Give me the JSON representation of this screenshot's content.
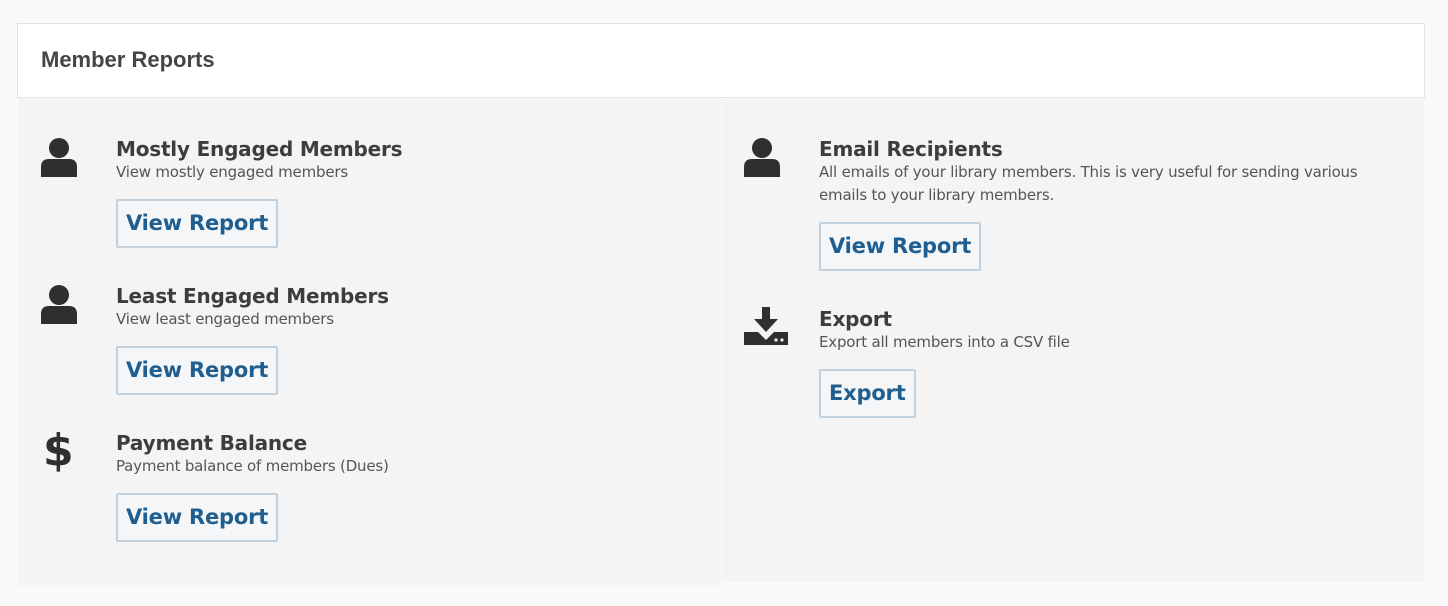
{
  "header": {
    "title": "Member Reports"
  },
  "left_items": [
    {
      "icon": "user-icon",
      "title": "Mostly Engaged Members",
      "description": "View mostly engaged members",
      "button_label": "View Report"
    },
    {
      "icon": "user-icon",
      "title": "Least Engaged Members",
      "description": "View least engaged members",
      "button_label": "View Report"
    },
    {
      "icon": "dollar-icon",
      "icon_glyph": "$",
      "title": "Payment Balance",
      "description": "Payment balance of members (Dues)",
      "button_label": "View Report"
    }
  ],
  "right_items": [
    {
      "icon": "user-icon",
      "title": "Email Recipients",
      "description": "All emails of your library members. This is very useful for sending various emails to your library members.",
      "button_label": "View Report"
    },
    {
      "icon": "download-icon",
      "title": "Export",
      "description": "Export all members into a CSV file",
      "button_label": "Export"
    }
  ],
  "colors": {
    "button_text": "#1f5e8e",
    "button_border": "#c3d1dc",
    "panel_bg": "#f4f4f4",
    "icon": "#2f2f2f"
  }
}
